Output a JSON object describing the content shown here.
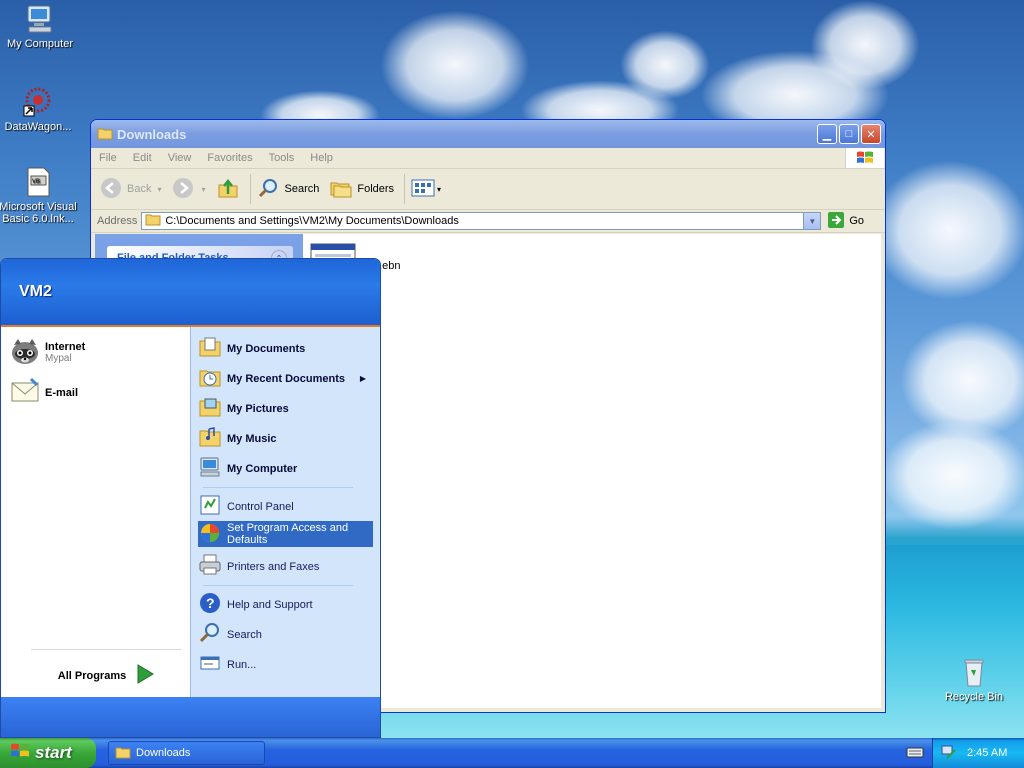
{
  "desktop": {
    "icons": [
      {
        "label": "My Computer"
      },
      {
        "label": "DataWagon..."
      },
      {
        "label": "Microsoft Visual Basic 6.0.lnk..."
      },
      {
        "label": "Recycle Bin"
      }
    ]
  },
  "window": {
    "title": "Downloads",
    "menu": [
      "File",
      "Edit",
      "View",
      "Favorites",
      "Tools",
      "Help"
    ],
    "toolbar": {
      "back_label": "Back",
      "search_label": "Search",
      "folders_label": "Folders"
    },
    "address": {
      "label": "Address",
      "path": "C:\\Documents and Settings\\VM2\\My Documents\\Downloads",
      "go_label": "Go"
    },
    "taskpane": {
      "header": "File and Folder Tasks"
    },
    "files": [
      {
        "name": "...ebn"
      }
    ]
  },
  "startmenu": {
    "user": "VM2",
    "pinned": [
      {
        "title": "Internet",
        "subtitle": "Mypal"
      },
      {
        "title": "E-mail",
        "subtitle": ""
      }
    ],
    "all_programs_label": "All Programs",
    "right": {
      "my_documents": "My Documents",
      "my_recent_documents": "My Recent Documents",
      "my_pictures": "My Pictures",
      "my_music": "My Music",
      "my_computer": "My Computer",
      "control_panel": "Control Panel",
      "set_program_access": "Set Program Access and Defaults",
      "printers_faxes": "Printers and Faxes",
      "help_support": "Help and Support",
      "search": "Search",
      "run": "Run..."
    }
  },
  "taskbar": {
    "start_label": "start",
    "tasks": [
      {
        "label": "Downloads"
      }
    ],
    "clock": "2:45 AM"
  }
}
